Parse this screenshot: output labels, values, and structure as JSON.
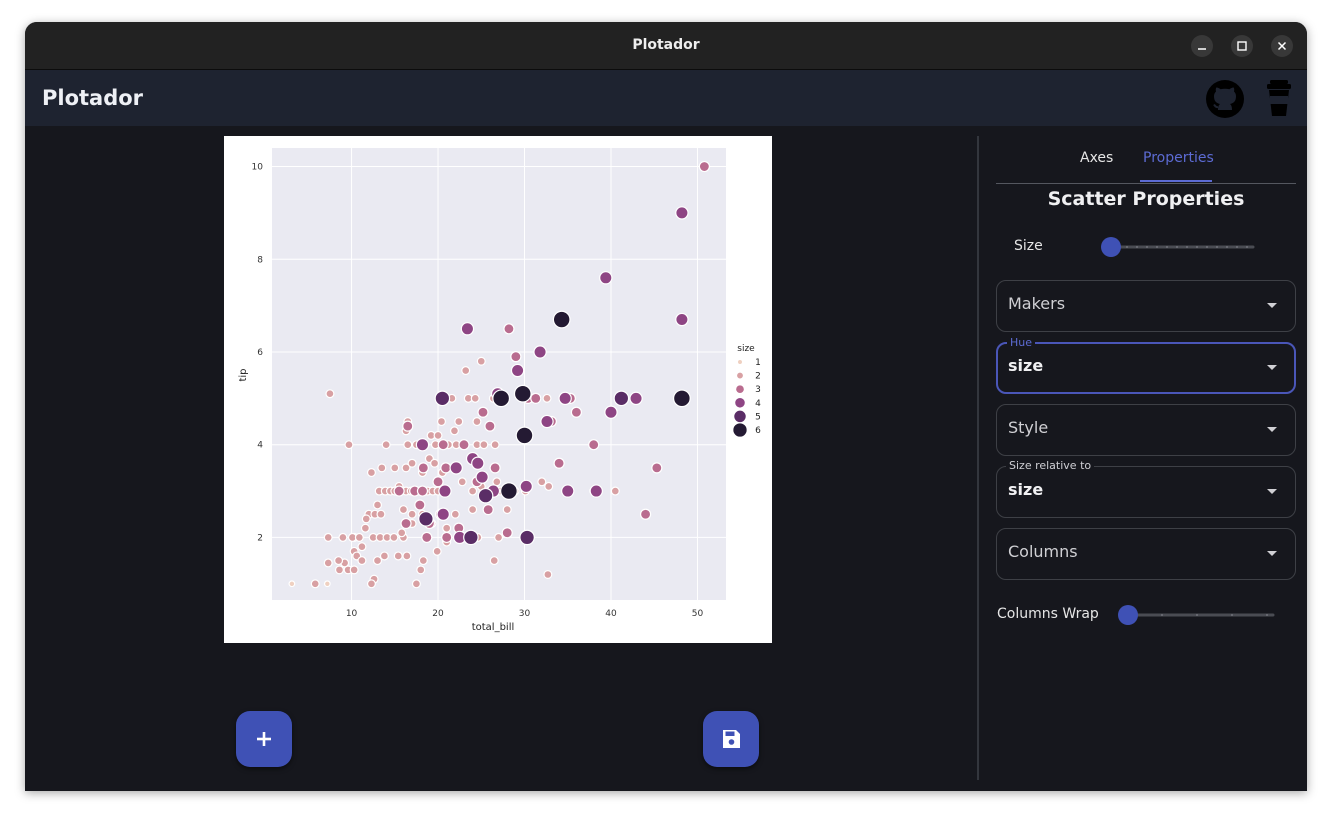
{
  "window": {
    "title": "Plotador"
  },
  "appbar": {
    "brand": "Plotador",
    "github_icon": "github-icon",
    "coffee_icon": "coffee-cup-icon"
  },
  "buttons": {
    "add_icon": "plus-icon",
    "save_icon": "floppy-disk-icon"
  },
  "panel": {
    "tabs": [
      {
        "label": "Axes",
        "active": false
      },
      {
        "label": "Properties",
        "active": true
      }
    ],
    "section_title": "Scatter Properties",
    "size_slider": {
      "label": "Size",
      "value": 0
    },
    "fields": [
      {
        "label": "",
        "value": "",
        "placeholder": "Makers",
        "focused": false
      },
      {
        "label": "Hue",
        "value": "size",
        "placeholder": "",
        "focused": true
      },
      {
        "label": "",
        "value": "",
        "placeholder": "Style",
        "focused": false
      },
      {
        "label": "Size relative to",
        "value": "size",
        "placeholder": "",
        "focused": false
      },
      {
        "label": "",
        "value": "",
        "placeholder": "Columns",
        "focused": false
      }
    ],
    "columns_wrap_slider": {
      "label": "Columns Wrap",
      "value": 0
    }
  },
  "colors": {
    "accent": "#3f51b5",
    "background": "#16171d",
    "appbar": "#1e2330",
    "plot_bg": "#eaeaf2"
  },
  "chart_data": {
    "type": "scatter",
    "xlabel": "total_bill",
    "ylabel": "tip",
    "xlim": [
      0.8,
      53.3
    ],
    "ylim": [
      0.65,
      10.4
    ],
    "xticks": [
      10,
      20,
      30,
      40,
      50
    ],
    "yticks": [
      2,
      4,
      6,
      8,
      10
    ],
    "grid": true,
    "legend": {
      "title": "size",
      "placement": "right",
      "entries": [
        "1",
        "2",
        "3",
        "4",
        "5",
        "6"
      ]
    },
    "hue_colors": {
      "1": "#efd0c0",
      "2": "#d8a0a3",
      "3": "#b96c8f",
      "4": "#8e4584",
      "5": "#5a2d66",
      "6": "#241a33"
    },
    "points": [
      [
        3.1,
        1.0,
        1
      ],
      [
        7.2,
        1.0,
        1
      ],
      [
        5.8,
        1.0,
        2
      ],
      [
        10.3,
        1.7,
        2
      ],
      [
        10.3,
        2.0,
        2
      ],
      [
        12.5,
        2.0,
        2
      ],
      [
        13.3,
        2.0,
        2
      ],
      [
        10.6,
        1.6,
        2
      ],
      [
        12.6,
        1.1,
        2
      ],
      [
        12.3,
        1.0,
        2
      ],
      [
        9.6,
        1.3,
        2
      ],
      [
        10.3,
        1.3,
        2
      ],
      [
        11.2,
        1.5,
        2
      ],
      [
        8.6,
        1.3,
        2
      ],
      [
        9.2,
        1.45,
        2
      ],
      [
        7.3,
        1.45,
        2
      ],
      [
        8.5,
        1.5,
        2
      ],
      [
        11.2,
        1.8,
        2
      ],
      [
        13.0,
        1.5,
        2
      ],
      [
        13.8,
        1.6,
        2
      ],
      [
        14.1,
        2.0,
        2
      ],
      [
        14.9,
        2.0,
        2
      ],
      [
        15.4,
        1.6,
        2
      ],
      [
        16.0,
        2.0,
        2
      ],
      [
        16.4,
        1.6,
        2
      ],
      [
        17.5,
        1.0,
        2
      ],
      [
        18.3,
        1.5,
        2
      ],
      [
        7.3,
        2.0,
        2
      ],
      [
        9.0,
        2.0,
        2
      ],
      [
        10.1,
        2.0,
        2
      ],
      [
        10.9,
        2.0,
        2
      ],
      [
        11.6,
        2.2,
        2
      ],
      [
        12.0,
        2.5,
        2
      ],
      [
        12.7,
        2.5,
        2
      ],
      [
        13.4,
        2.5,
        2
      ],
      [
        13.0,
        2.7,
        2
      ],
      [
        13.2,
        3.0,
        2
      ],
      [
        13.9,
        3.0,
        2
      ],
      [
        14.5,
        3.0,
        2
      ],
      [
        15.0,
        3.0,
        2
      ],
      [
        15.5,
        3.1,
        2
      ],
      [
        16.3,
        3.0,
        2
      ],
      [
        16.9,
        3.0,
        2
      ],
      [
        17.5,
        3.0,
        2
      ],
      [
        18.0,
        3.0,
        2
      ],
      [
        18.8,
        3.0,
        2
      ],
      [
        19.4,
        3.0,
        2
      ],
      [
        20.0,
        3.0,
        2
      ],
      [
        16.0,
        2.6,
        2
      ],
      [
        17.0,
        2.5,
        2
      ],
      [
        18.2,
        2.5,
        2
      ],
      [
        19.3,
        2.3,
        2
      ],
      [
        21.0,
        2.2,
        2
      ],
      [
        22.0,
        2.5,
        2
      ],
      [
        23.6,
        2.0,
        2
      ],
      [
        24.0,
        2.6,
        2
      ],
      [
        22.8,
        3.2,
        2
      ],
      [
        24.0,
        3.0,
        2
      ],
      [
        25.0,
        3.1,
        2
      ],
      [
        26.0,
        3.0,
        2
      ],
      [
        27.2,
        3.0,
        2
      ],
      [
        28.9,
        3.0,
        2
      ],
      [
        30.1,
        3.0,
        2
      ],
      [
        32.0,
        3.2,
        2
      ],
      [
        32.8,
        3.1,
        2
      ],
      [
        38.0,
        3.0,
        2
      ],
      [
        40.5,
        3.0,
        2
      ],
      [
        16.3,
        3.5,
        2
      ],
      [
        17.0,
        3.6,
        2
      ],
      [
        18.2,
        3.4,
        2
      ],
      [
        19.0,
        3.7,
        2
      ],
      [
        19.6,
        3.6,
        2
      ],
      [
        20.5,
        3.4,
        2
      ],
      [
        12.3,
        3.4,
        2
      ],
      [
        13.5,
        3.5,
        2
      ],
      [
        15.0,
        3.5,
        2
      ],
      [
        16.5,
        4.0,
        2
      ],
      [
        17.5,
        4.0,
        2
      ],
      [
        18.5,
        4.0,
        2
      ],
      [
        19.7,
        4.0,
        2
      ],
      [
        21.2,
        4.0,
        2
      ],
      [
        22.1,
        4.0,
        2
      ],
      [
        23.1,
        4.0,
        2
      ],
      [
        24.5,
        4.0,
        2
      ],
      [
        25.3,
        4.0,
        2
      ],
      [
        26.6,
        4.0,
        2
      ],
      [
        16.3,
        4.3,
        2
      ],
      [
        19.2,
        4.2,
        2
      ],
      [
        20.0,
        4.2,
        2
      ],
      [
        21.9,
        4.3,
        2
      ],
      [
        14.0,
        4.0,
        2
      ],
      [
        9.7,
        4.0,
        2
      ],
      [
        16.5,
        4.5,
        2
      ],
      [
        20.4,
        4.5,
        2
      ],
      [
        22.4,
        4.5,
        2
      ],
      [
        24.5,
        4.5,
        2
      ],
      [
        21.6,
        5.0,
        2
      ],
      [
        23.5,
        5.0,
        2
      ],
      [
        24.3,
        5.0,
        2
      ],
      [
        26.4,
        5.0,
        2
      ],
      [
        30.2,
        5.0,
        2
      ],
      [
        32.6,
        5.0,
        2
      ],
      [
        7.5,
        5.1,
        2
      ],
      [
        23.2,
        5.6,
        2
      ],
      [
        25.0,
        5.8,
        2
      ],
      [
        26.8,
        3.2,
        2
      ],
      [
        28.0,
        2.6,
        2
      ],
      [
        30.3,
        2.0,
        2
      ],
      [
        26.5,
        1.5,
        2
      ],
      [
        32.7,
        1.2,
        2
      ],
      [
        24.6,
        2.0,
        2
      ],
      [
        27.0,
        2.0,
        2
      ],
      [
        15.8,
        2.1,
        2
      ],
      [
        17.0,
        2.3,
        2
      ],
      [
        19.9,
        1.7,
        2
      ],
      [
        21.0,
        1.9,
        2
      ],
      [
        18.0,
        1.3,
        2
      ],
      [
        11.7,
        2.4,
        2
      ],
      [
        15.5,
        3.0,
        3
      ],
      [
        17.3,
        3.0,
        3
      ],
      [
        18.3,
        3.5,
        3
      ],
      [
        20.0,
        3.2,
        3
      ],
      [
        17.9,
        2.7,
        3
      ],
      [
        19.0,
        2.3,
        3
      ],
      [
        16.3,
        2.3,
        3
      ],
      [
        21.0,
        2.0,
        3
      ],
      [
        22.4,
        2.2,
        3
      ],
      [
        25.8,
        2.6,
        3
      ],
      [
        18.7,
        2.0,
        3
      ],
      [
        20.3,
        2.5,
        3
      ],
      [
        23.0,
        4.0,
        3
      ],
      [
        24.5,
        3.2,
        3
      ],
      [
        25.2,
        4.7,
        3
      ],
      [
        26.6,
        3.5,
        3
      ],
      [
        28.0,
        2.1,
        3
      ],
      [
        29.0,
        5.9,
        3
      ],
      [
        30.4,
        5.0,
        3
      ],
      [
        31.3,
        5.0,
        3
      ],
      [
        33.1,
        4.5,
        3
      ],
      [
        34.0,
        3.6,
        3
      ],
      [
        35.3,
        5.0,
        3
      ],
      [
        36.0,
        4.7,
        3
      ],
      [
        38.0,
        4.0,
        3
      ],
      [
        28.2,
        6.5,
        3
      ],
      [
        50.8,
        10.0,
        3
      ],
      [
        44.0,
        2.5,
        3
      ],
      [
        45.3,
        3.5,
        3
      ],
      [
        16.5,
        4.4,
        3
      ],
      [
        18.2,
        3.0,
        3
      ],
      [
        20.9,
        3.5,
        3
      ],
      [
        26.0,
        4.4,
        3
      ],
      [
        20.6,
        4.0,
        3
      ],
      [
        23.4,
        6.5,
        4
      ],
      [
        18.2,
        4.0,
        4
      ],
      [
        20.8,
        3.0,
        4
      ],
      [
        22.1,
        3.5,
        4
      ],
      [
        24.0,
        3.7,
        4
      ],
      [
        26.4,
        3.0,
        4
      ],
      [
        29.2,
        5.6,
        4
      ],
      [
        31.8,
        6.0,
        4
      ],
      [
        32.6,
        4.5,
        4
      ],
      [
        34.7,
        5.0,
        4
      ],
      [
        35.0,
        3.0,
        4
      ],
      [
        39.4,
        7.6,
        4
      ],
      [
        40.0,
        4.7,
        4
      ],
      [
        42.9,
        5.0,
        4
      ],
      [
        48.2,
        9.0,
        4
      ],
      [
        48.2,
        6.7,
        4
      ],
      [
        38.3,
        3.0,
        4
      ],
      [
        30.2,
        3.1,
        4
      ],
      [
        20.6,
        2.5,
        4
      ],
      [
        25.1,
        3.3,
        4
      ],
      [
        22.5,
        2.0,
        4
      ],
      [
        26.9,
        5.1,
        4
      ],
      [
        24.6,
        3.6,
        4
      ],
      [
        20.5,
        5.0,
        5
      ],
      [
        23.8,
        2.0,
        5
      ],
      [
        25.5,
        2.9,
        5
      ],
      [
        28.2,
        3.0,
        5
      ],
      [
        30.3,
        2.0,
        5
      ],
      [
        34.2,
        6.7,
        5
      ],
      [
        41.2,
        5.0,
        5
      ],
      [
        18.6,
        2.4,
        5
      ],
      [
        27.3,
        5.0,
        6
      ],
      [
        29.8,
        5.1,
        6
      ],
      [
        30.0,
        4.2,
        6
      ],
      [
        34.3,
        6.7,
        6
      ],
      [
        48.2,
        5.0,
        6
      ],
      [
        28.2,
        3.0,
        6
      ]
    ]
  }
}
